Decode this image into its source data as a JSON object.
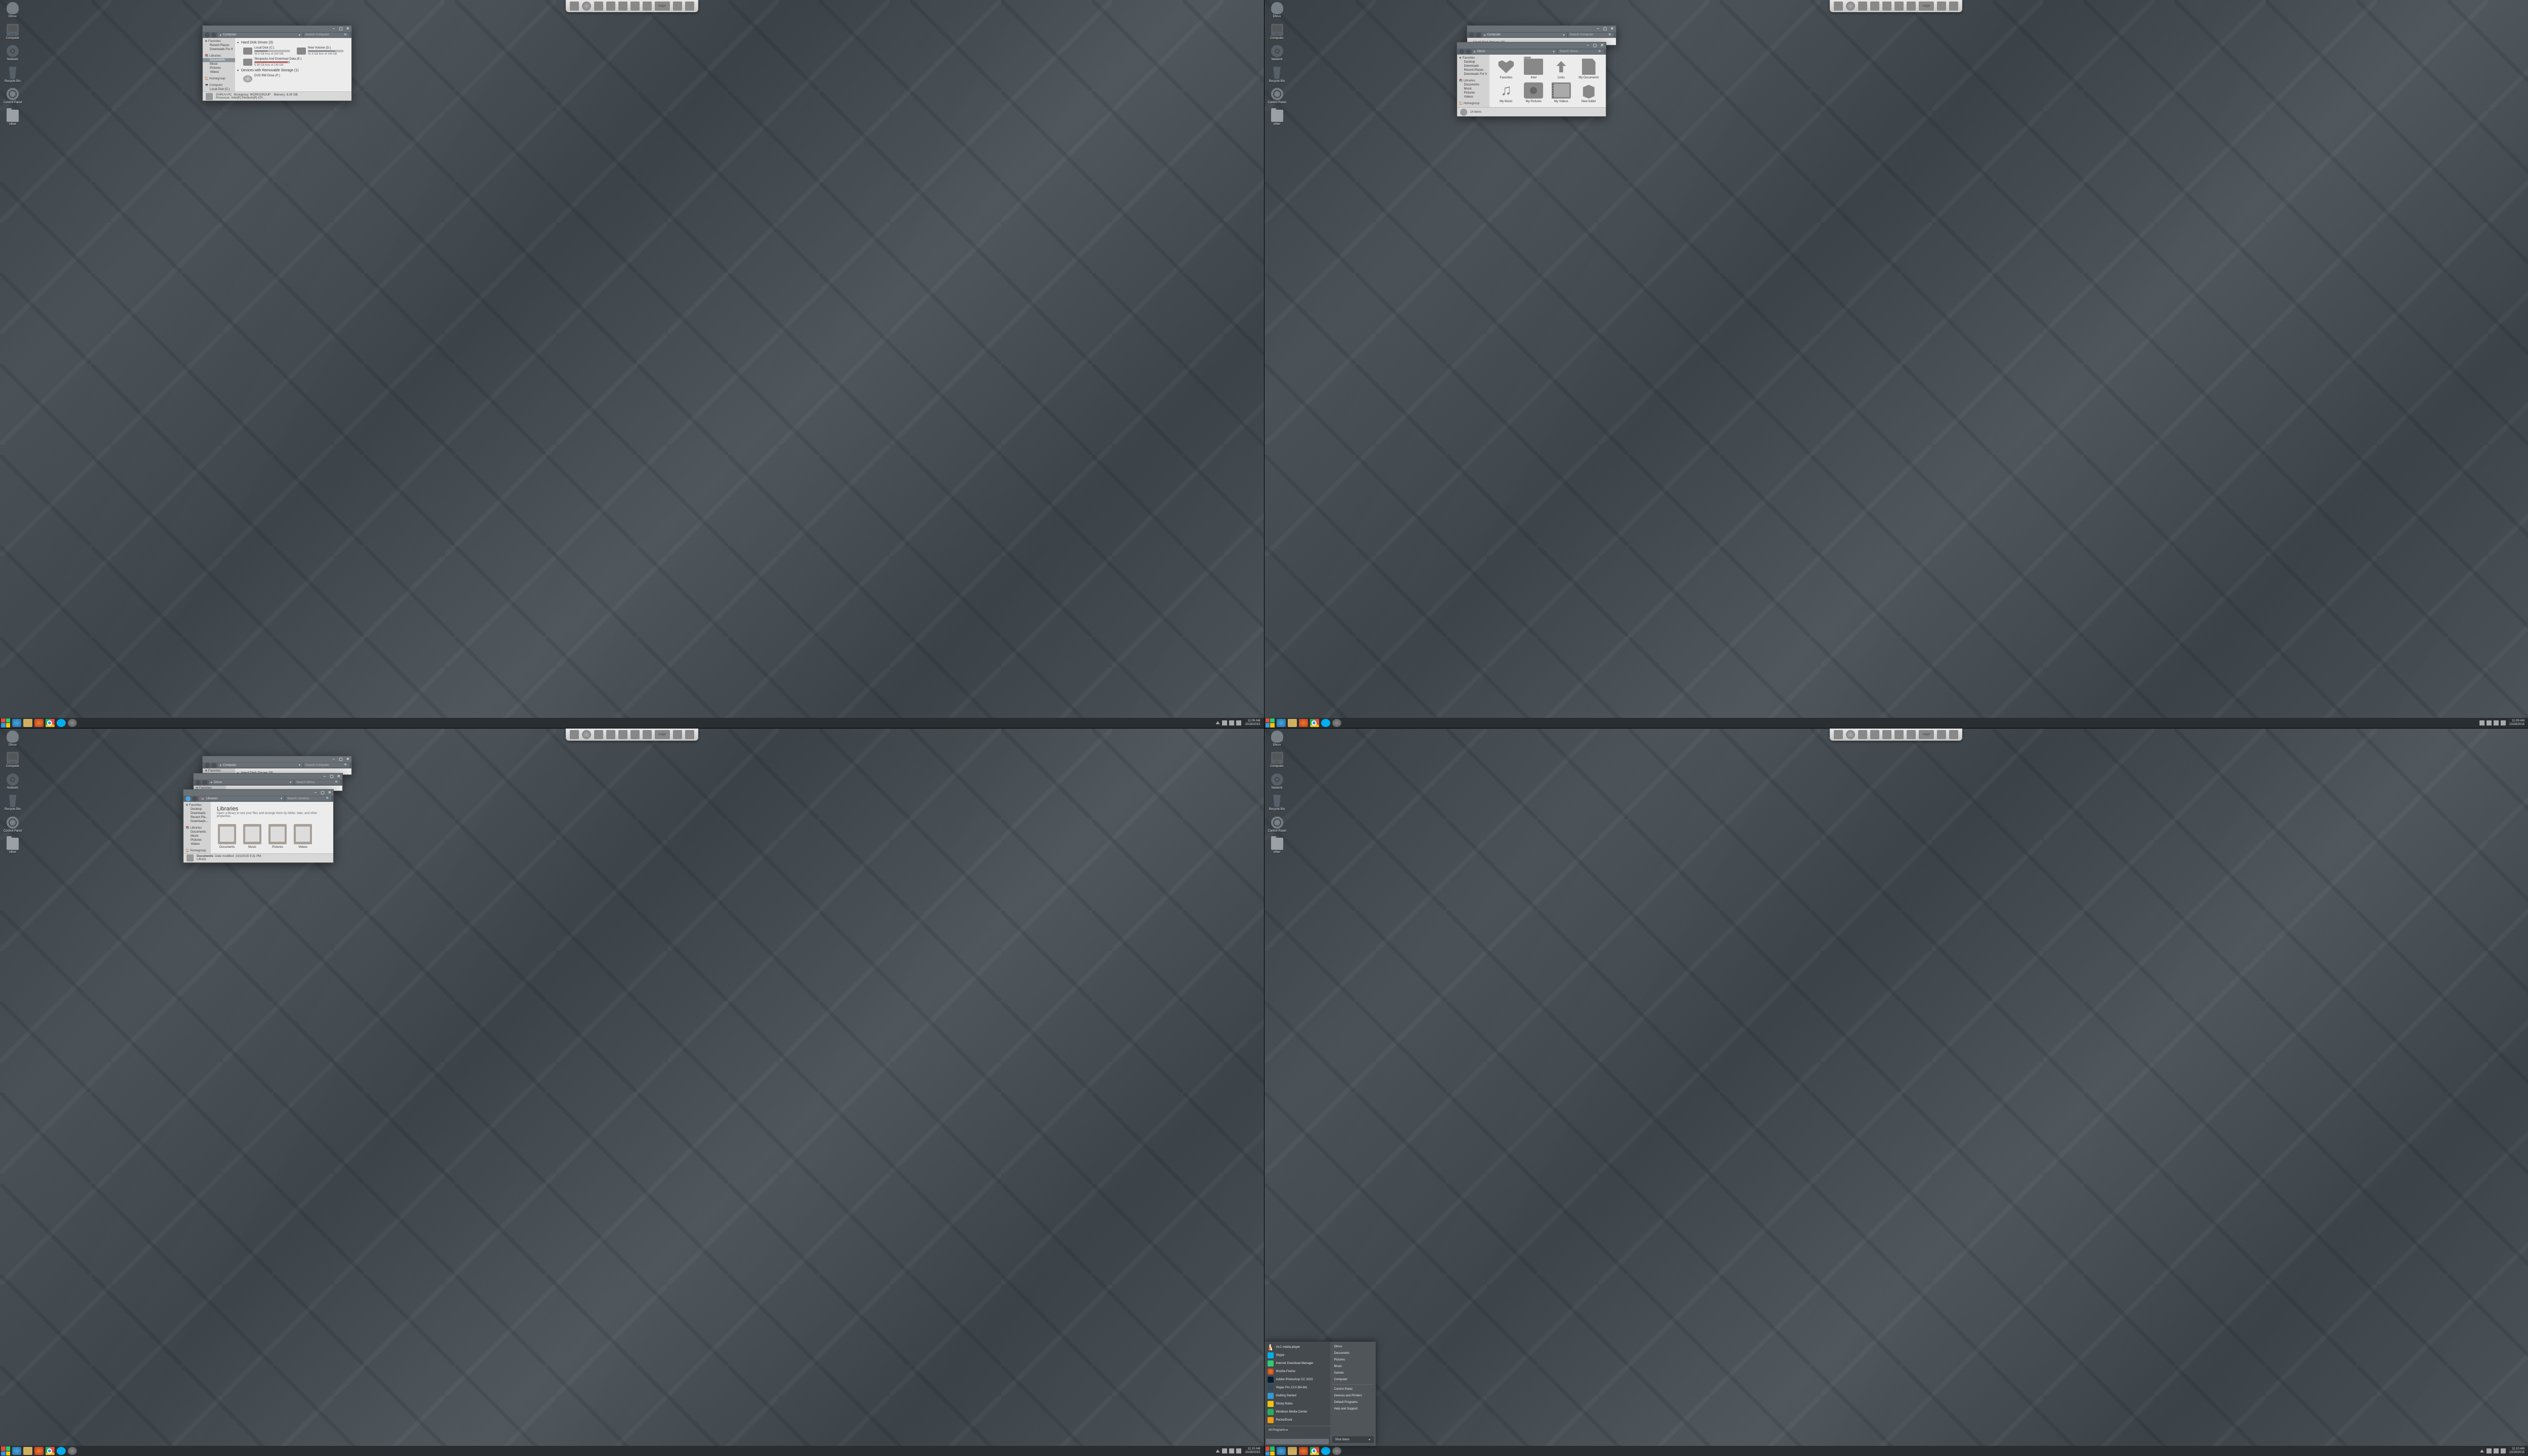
{
  "user_label": "Dhruv",
  "desktop_icons": [
    "Computer",
    "Network",
    "Recycle Bin",
    "Control Panel",
    "other"
  ],
  "dock_sugar": "sugar",
  "taskbar": {
    "time": "11:09 AM",
    "date": "10/28/2015",
    "time2": "11:10 AM"
  },
  "explorer_computer": {
    "crumb_root": "▸",
    "crumb": "Computer",
    "search": "Search Computer",
    "section1": "Hard Disk Drives (3)",
    "section2": "Devices with Removable Storage (1)",
    "drives": [
      {
        "name": "Local Disk (C:)",
        "free": "94.6 GB free of 150 GB",
        "fill": 37
      },
      {
        "name": "New Volume (D:)",
        "free": "41.9 GB free of 194 GB",
        "fill": 78
      },
      {
        "name": "Skinpacks And Download Data (E:)",
        "free": "5.38 GB free of 140 GB",
        "fill": 96,
        "red": true
      }
    ],
    "dvd": "DVD RW Drive (F:)",
    "status_pc": "DHRUV-PC",
    "status_wg": "Workgroup: WORKGROUP",
    "status_mem": "Memory: 6.00 GB",
    "status_cpu": "Processor: Intel(R) Pentium(R) CP..."
  },
  "sidebar_groups": [
    {
      "h": "★ Favorites",
      "items": [
        "Recent Places",
        "Downloads For It"
      ]
    },
    {
      "h": "📚 Libraries",
      "items": [
        "Documents",
        "Music",
        "Pictures",
        "Videos"
      ]
    },
    {
      "h": "🏠 Homegroup",
      "items": []
    },
    {
      "h": "💻 Computer",
      "items": [
        "Local Disk (C:)"
      ]
    }
  ],
  "sidebar_dhruv": [
    {
      "h": "★ Favorites",
      "items": [
        "Desktop",
        "Downloads",
        "Recent Places",
        "Downloads For It"
      ]
    },
    {
      "h": "📚 Libraries",
      "items": [
        "Documents",
        "Music",
        "Pictures",
        "Videos"
      ]
    },
    {
      "h": "🏠 Homegroup",
      "items": []
    }
  ],
  "dhruv_win": {
    "crumb": "Dhruv",
    "search": "Search Dhruv",
    "icons": [
      {
        "n": "Favorites",
        "c": "heart"
      },
      {
        "n": "Intel",
        "c": "folder"
      },
      {
        "n": "Links",
        "c": "links"
      },
      {
        "n": "My Documents",
        "c": "doc"
      },
      {
        "n": "My Music",
        "c": "music"
      },
      {
        "n": "My Pictures",
        "c": "cam"
      },
      {
        "n": "My Videos",
        "c": "vid"
      },
      {
        "n": "New folder",
        "c": "box"
      }
    ],
    "status": "14 items"
  },
  "lib_win": {
    "crumb": "Libraries",
    "search": "Search Libraries",
    "title": "Libraries",
    "sub": "Open a library to see your files and arrange them by folder, date, and other properties.",
    "items": [
      "Documents",
      "Music",
      "Pictures",
      "Videos"
    ],
    "status_name": "Documents",
    "status_mod": "Date modified: 10/2/2015 9:31 PM",
    "status_type": "Library"
  },
  "start": {
    "apps": [
      {
        "n": "VLC media player",
        "c": "vlc"
      },
      {
        "n": "Skype",
        "c": "sky"
      },
      {
        "n": "Internet Download Manager",
        "c": "idm"
      },
      {
        "n": "Mozilla Firefox",
        "c": "ff"
      },
      {
        "n": "Adobe Photoshop CC 2015",
        "c": "ps"
      },
      {
        "n": "Vegas Pro 13.0 (64-bit)",
        "c": "vp"
      },
      {
        "n": "Getting Started",
        "c": "gs"
      },
      {
        "n": "Sticky Notes",
        "c": "sn"
      },
      {
        "n": "Windows Media Center",
        "c": "wmc"
      },
      {
        "n": "RocketDock",
        "c": "rd"
      }
    ],
    "all": "All Programs",
    "search_ph": "Search programs and files",
    "right": [
      "Dhruv",
      "Documents",
      "Pictures",
      "Music",
      "Games",
      "Computer",
      "",
      "Control Panel",
      "Devices and Printers",
      "Default Programs",
      "Help and Support"
    ],
    "shut": "Shut down"
  }
}
